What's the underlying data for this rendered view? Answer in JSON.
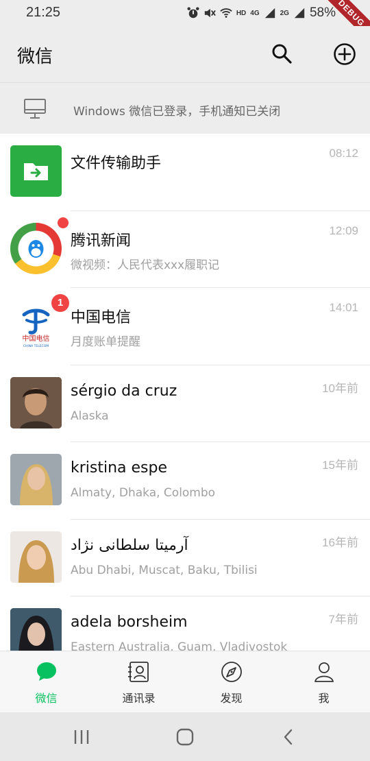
{
  "status": {
    "time": "21:25",
    "hd": "HD",
    "net1": "4G",
    "net2": "2G",
    "battery": "58%",
    "debug": "DEBUG"
  },
  "app_bar": {
    "title": "微信"
  },
  "banner": {
    "text": "Windows 微信已登录，手机通知已关闭"
  },
  "chats": [
    {
      "name": "文件传输助手",
      "preview": "",
      "time": "08:12"
    },
    {
      "name": "腾讯新闻",
      "preview": "微视频：人民代表xxx履职记",
      "time": "12:09"
    },
    {
      "name": "中国电信",
      "preview": "月度账单提醒",
      "time": "14:01",
      "badge": "1",
      "logo_text": "中国电信",
      "logo_sub": "CHINA TELECOM"
    },
    {
      "name": "sérgio da cruz",
      "preview": "Alaska",
      "time": "10年前"
    },
    {
      "name": "kristina espe",
      "preview": "Almaty, Dhaka, Colombo",
      "time": "15年前"
    },
    {
      "name": "آرمیتا سلطانی نژاد",
      "preview": "Abu Dhabi, Muscat, Baku, Tbilisi",
      "time": "16年前"
    },
    {
      "name": "adela borsheim",
      "preview": "Eastern Australia, Guam, Vladivostok",
      "time": "7年前"
    }
  ],
  "nav": [
    {
      "label": "微信"
    },
    {
      "label": "通讯录"
    },
    {
      "label": "发现"
    },
    {
      "label": "我"
    }
  ],
  "colors": {
    "accent": "#07c160",
    "badge": "#f04343",
    "file_helper": "#2aae43"
  }
}
